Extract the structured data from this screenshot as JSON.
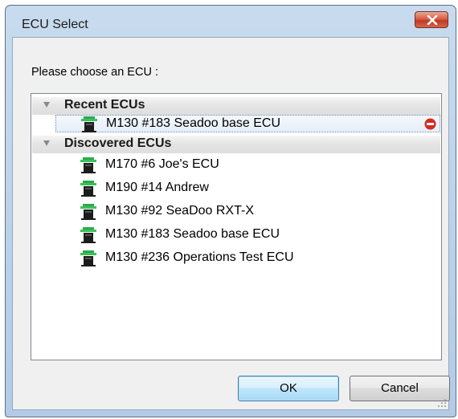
{
  "window": {
    "title": "ECU Select"
  },
  "dialog": {
    "prompt": "Please choose an ECU :"
  },
  "groups": [
    {
      "label": "Recent ECUs",
      "items": [
        {
          "label": "M130 #183 Seadoo base ECU",
          "selected": true,
          "removable": true
        }
      ]
    },
    {
      "label": "Discovered ECUs",
      "items": [
        {
          "label": "M170 #6 Joe's ECU"
        },
        {
          "label": "M190 #14 Andrew"
        },
        {
          "label": "M130 #92 SeaDoo RXT-X"
        },
        {
          "label": "M130 #183 Seadoo base ECU"
        },
        {
          "label": "M130 #236 Operations Test ECU"
        }
      ]
    }
  ],
  "buttons": {
    "ok": "OK",
    "cancel": "Cancel"
  },
  "icons": {
    "close": "close-icon",
    "ecu": "ecu-device-icon",
    "remove": "remove-icon",
    "expand": "collapse-triangle-icon"
  },
  "colors": {
    "close_button": "#c7422b",
    "remove_badge": "#d62a1f",
    "ecu_icon_green": "#2fa84a"
  }
}
